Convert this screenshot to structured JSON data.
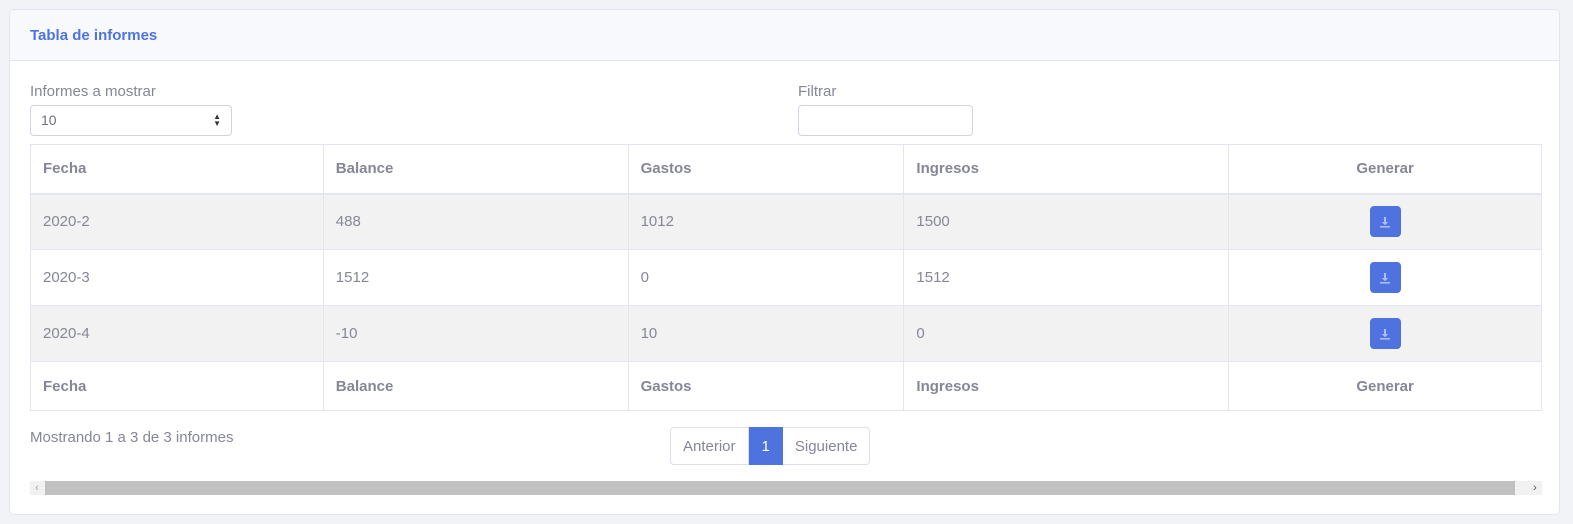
{
  "card": {
    "title": "Tabla de informes"
  },
  "controls": {
    "length_label": "Informes a mostrar",
    "length_value": "10",
    "filter_label": "Filtrar",
    "filter_value": ""
  },
  "table": {
    "headers": [
      "Fecha",
      "Balance",
      "Gastos",
      "Ingresos",
      "Generar"
    ],
    "rows": [
      {
        "fecha": "2020-2",
        "balance": "488",
        "gastos": "1012",
        "ingresos": "1500"
      },
      {
        "fecha": "2020-3",
        "balance": "1512",
        "gastos": "0",
        "ingresos": "1512"
      },
      {
        "fecha": "2020-4",
        "balance": "-10",
        "gastos": "10",
        "ingresos": "0"
      }
    ],
    "action_icon": "download-icon"
  },
  "footer": {
    "info": "Mostrando 1 a 3 de 3 informes",
    "prev": "Anterior",
    "page": "1",
    "next": "Siguiente"
  },
  "colors": {
    "accent": "#4e73df",
    "text": "#858796",
    "stripe": "#f2f2f2"
  }
}
